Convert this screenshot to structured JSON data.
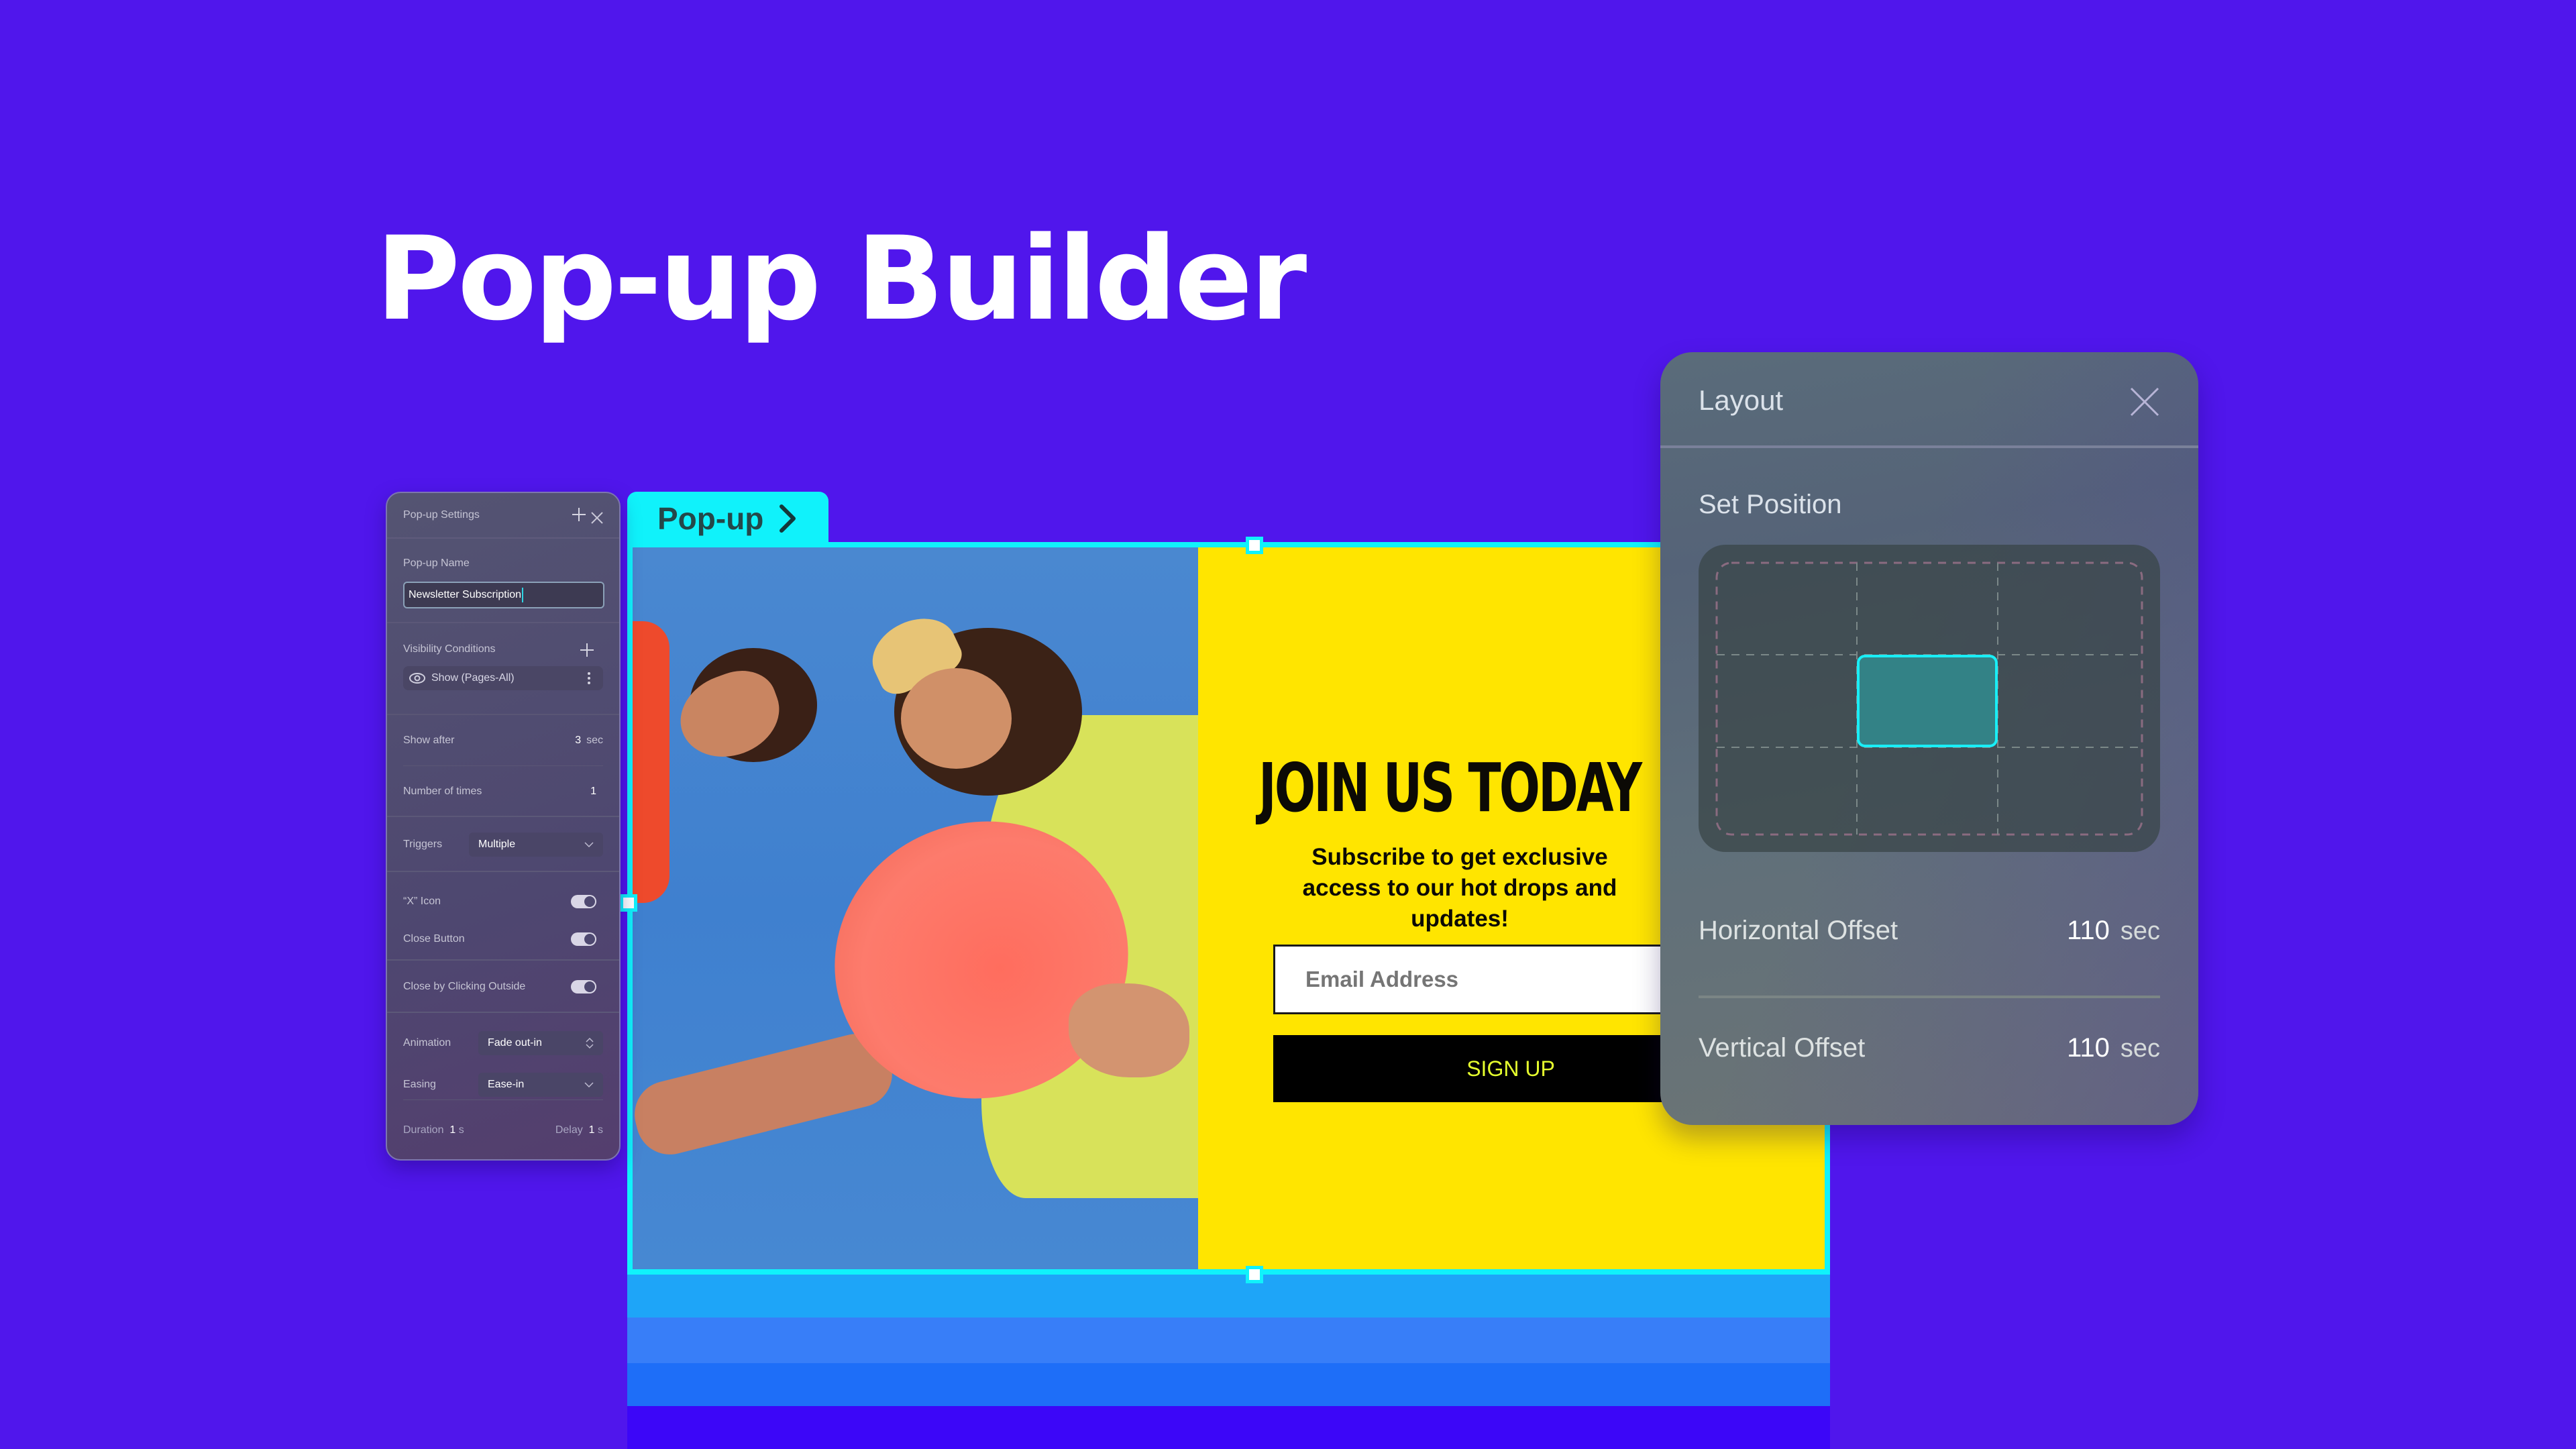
{
  "hero": {
    "title": "Pop-up Builder"
  },
  "colors": {
    "background": "#5016ec",
    "accent_cyan": "#10f2fb",
    "promo_yellow": "#ffe500",
    "signup_text": "#e6ff2e",
    "strips": [
      "#1ea5f8",
      "#387ef8",
      "#1e6ef8",
      "#3c06f8"
    ]
  },
  "canvas": {
    "tab_label": "Pop-up",
    "tab_icon": "chevron-right-icon",
    "image_alt": "Two people laughing holding a coral frisbee against a blue sky",
    "promo": {
      "title": "JOIN US TODAY",
      "subtitle": "Subscribe to get exclusive access to our hot drops and updates!",
      "email_placeholder": "Email Address",
      "signup_label": "SIGN UP"
    }
  },
  "settings_panel": {
    "title": "Pop-up Settings",
    "name_label": "Pop-up Name",
    "name_value": "Newsletter Subscription",
    "visibility_label": "Visibility Conditions",
    "visibility_item": "Show (Pages-All)",
    "show_after_label": "Show after",
    "show_after_value": "3",
    "show_after_unit": "sec",
    "times_label": "Number of times",
    "times_value": "1",
    "triggers_label": "Triggers",
    "triggers_value": "Multiple",
    "x_icon_label": "“X” Icon",
    "x_icon_on": true,
    "close_button_label": "Close Button",
    "close_button_on": true,
    "close_outside_label": "Close by Clicking Outside",
    "close_outside_on": true,
    "animation_label": "Animation",
    "animation_value": "Fade out-in",
    "easing_label": "Easing",
    "easing_value": "Ease-in",
    "duration_label": "Duration",
    "duration_value": "1",
    "duration_unit": "s",
    "delay_label": "Delay",
    "delay_value": "1",
    "delay_unit": "s"
  },
  "layout_panel": {
    "title": "Layout",
    "set_position_label": "Set Position",
    "selected_position": "center",
    "horizontal_offset_label": "Horizontal Offset",
    "horizontal_offset_value": "110",
    "horizontal_offset_unit": "sec",
    "vertical_offset_label": "Vertical Offset",
    "vertical_offset_value": "110",
    "vertical_offset_unit": "sec"
  }
}
